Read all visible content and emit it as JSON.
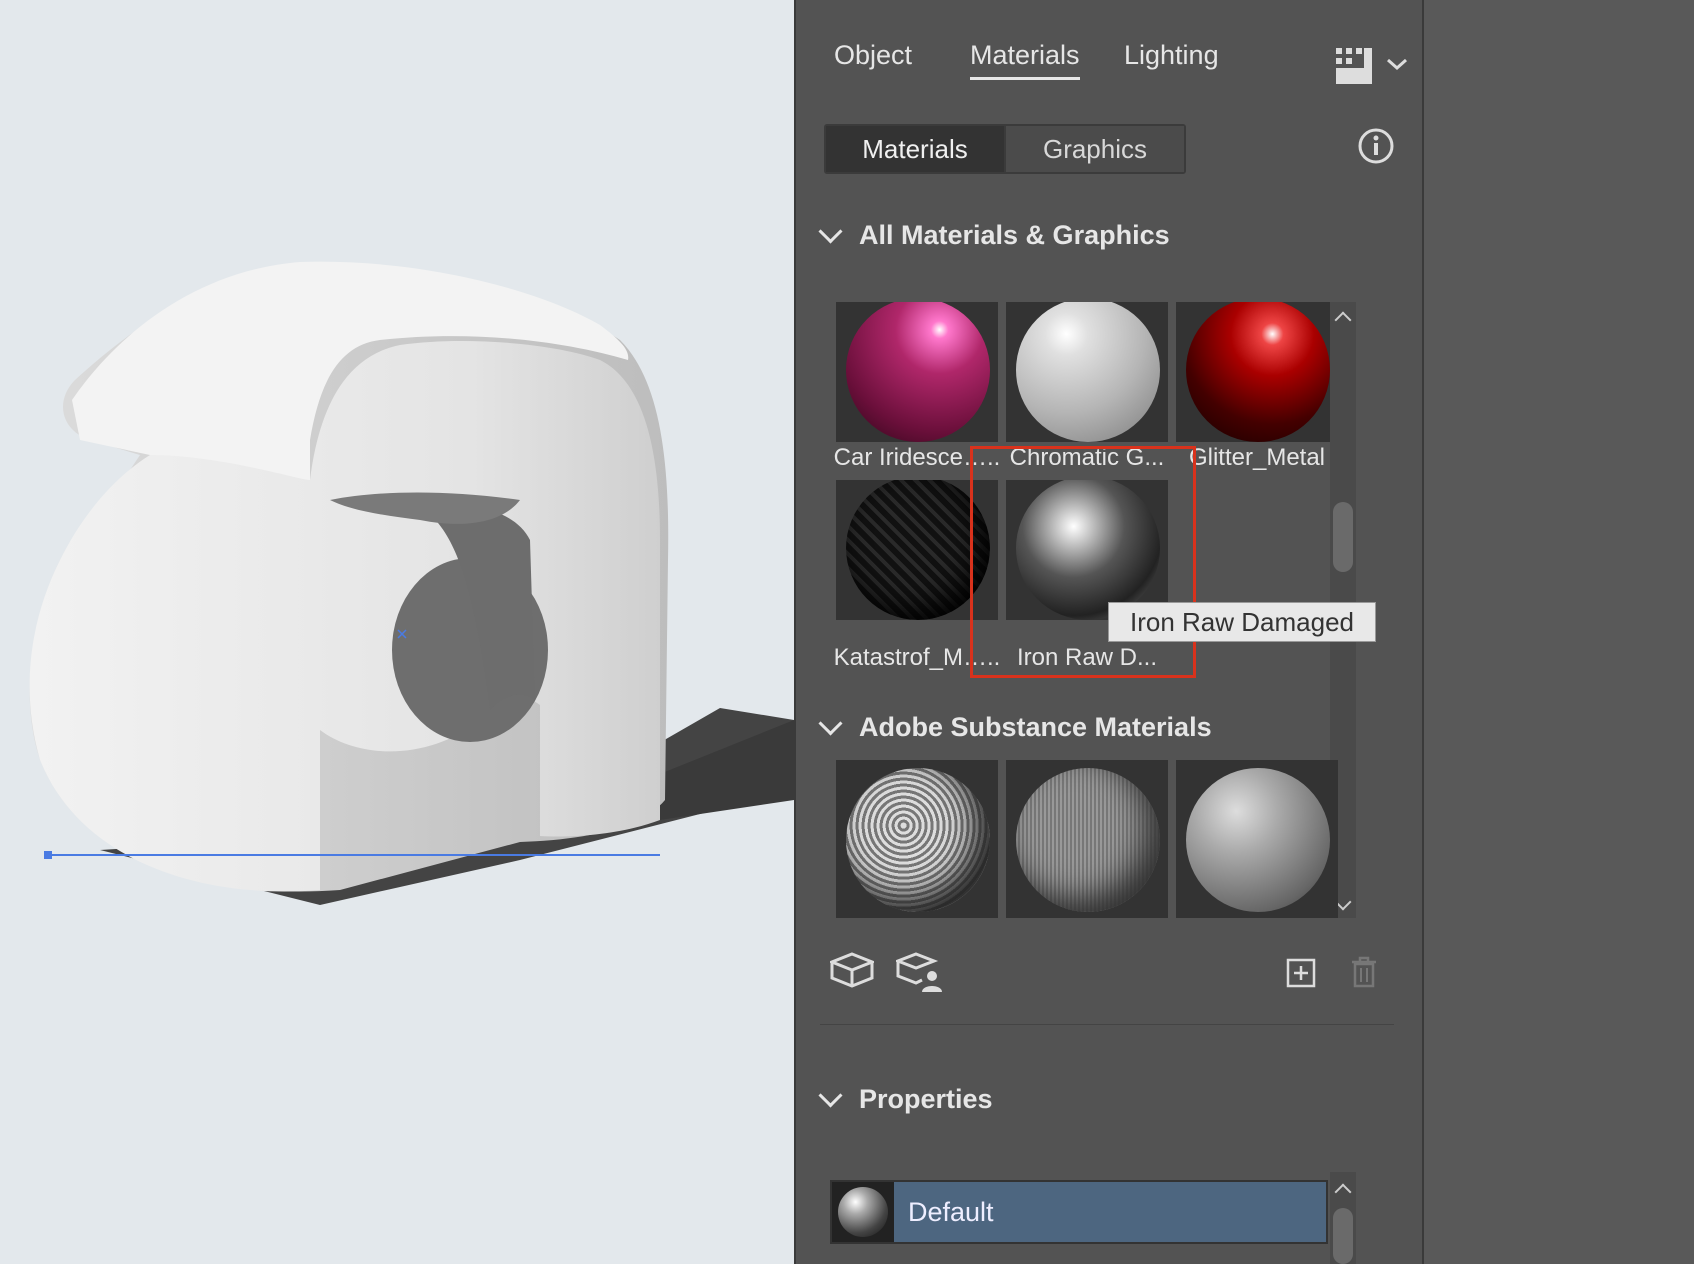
{
  "tabs": [
    {
      "label": "Object"
    },
    {
      "label": "Materials"
    },
    {
      "label": "Lighting"
    }
  ],
  "segment": {
    "materials": "Materials",
    "graphics": "Graphics"
  },
  "sections": {
    "all": "All Materials & Graphics",
    "substance": "Adobe Substance Materials",
    "properties": "Properties"
  },
  "materials": [
    {
      "label": "Car Iridesce….."
    },
    {
      "label": "Chromatic G..."
    },
    {
      "label": "Glitter_Metal"
    },
    {
      "label": "Katastrof_M….."
    },
    {
      "label": "Iron Raw D..."
    }
  ],
  "tooltip": "Iron Raw Damaged",
  "properties": {
    "selected": "Default"
  }
}
